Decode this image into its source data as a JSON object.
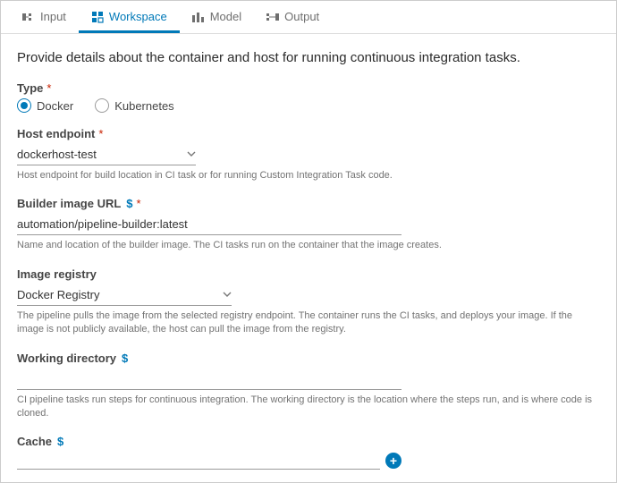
{
  "tabs": {
    "input": "Input",
    "workspace": "Workspace",
    "model": "Model",
    "output": "Output"
  },
  "page": {
    "description": "Provide details about the container and host for running continuous integration tasks."
  },
  "type": {
    "label": "Type",
    "options": {
      "docker": "Docker",
      "kubernetes": "Kubernetes"
    },
    "selected": "docker"
  },
  "hostEndpoint": {
    "label": "Host endpoint",
    "value": "dockerhost-test",
    "help": "Host endpoint for build location in CI task or for running Custom Integration Task code."
  },
  "builderImage": {
    "label": "Builder image URL",
    "value": "automation/pipeline-builder:latest",
    "help": "Name and location of the builder image. The CI tasks run on the container that the image creates."
  },
  "imageRegistry": {
    "label": "Image registry",
    "value": "Docker Registry",
    "help": "The pipeline pulls the image from the selected registry endpoint. The container runs the CI tasks, and deploys your image. If the image is not publicly available, the host can pull the image from the registry."
  },
  "workingDir": {
    "label": "Working directory",
    "value": "",
    "help": "CI pipeline tasks run steps for continuous integration. The working directory is the location where the steps run, and is where code is cloned."
  },
  "cache": {
    "label": "Cache"
  },
  "symbols": {
    "variable": "$",
    "required": "*",
    "plus": "+"
  }
}
